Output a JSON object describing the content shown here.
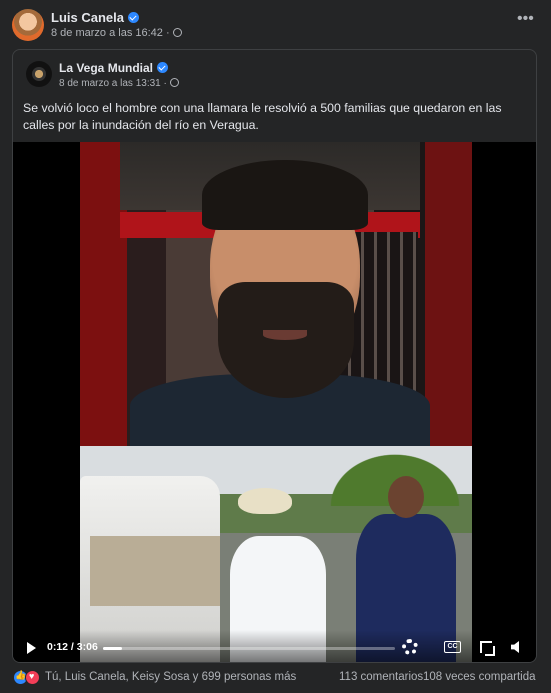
{
  "post": {
    "author": "Luis Canela",
    "time": "8 de marzo a las 16:42 ·"
  },
  "shared": {
    "author": "La Vega Mundial",
    "time": "8 de marzo a las 13:31 ·",
    "caption": "Se volvió loco el hombre con una llamara le resolvió a 500 familias que quedaron en las calles por la inundación del río en Veragua."
  },
  "video": {
    "current_time": "0:12",
    "duration": "3:06",
    "time_display": "0:12 / 3:06",
    "progress": 0.0645,
    "cc_label": "CC"
  },
  "footer": {
    "reactors": "Tú, Luis Canela, Keisy Sosa y 699 personas más",
    "comments": "113 comentarios",
    "shares": "108 veces compartida"
  },
  "icons": {
    "verified": "verified-badge-icon",
    "globe": "globe-icon",
    "more": "more-options-icon",
    "play": "play-icon",
    "gear": "gear-icon",
    "cc": "captions-icon",
    "fullscreen": "fullscreen-icon",
    "mute": "volume-muted-icon"
  },
  "colors": {
    "background": "#242526",
    "accent": "#2d88ff",
    "love": "#f33e58"
  }
}
